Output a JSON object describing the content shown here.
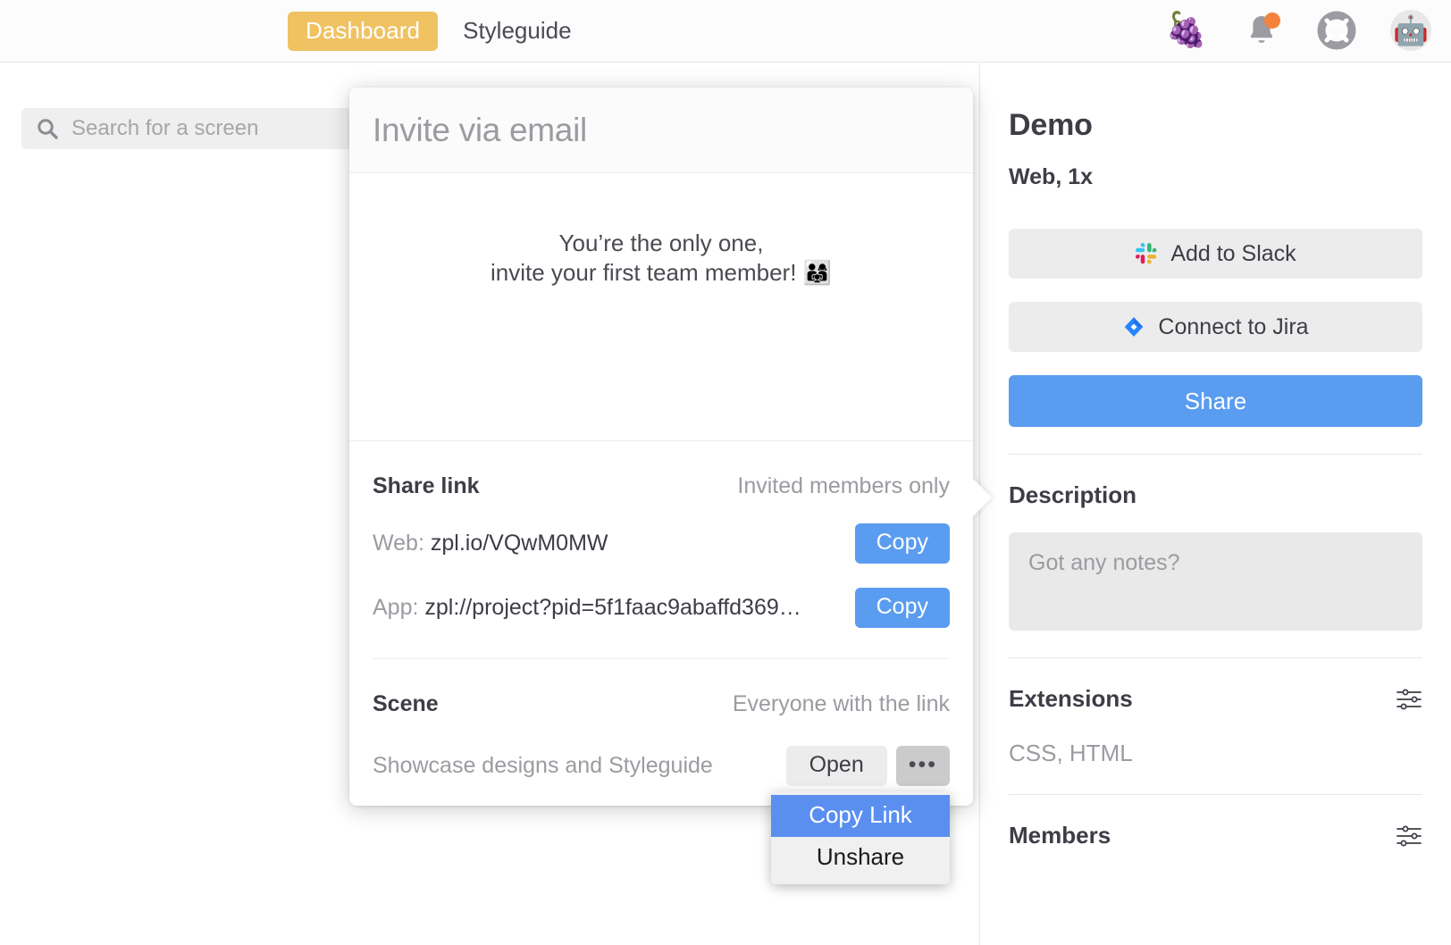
{
  "topbar": {
    "nav": [
      {
        "label": "Dashboard",
        "active": true
      },
      {
        "label": "Styleguide",
        "active": false
      }
    ],
    "icons": [
      {
        "name": "grapes-icon",
        "glyph": "🍇"
      },
      {
        "name": "notifications-bell-icon",
        "glyph": "bell",
        "badge": true
      },
      {
        "name": "help-lifebuoy-icon",
        "glyph": "lifebuoy"
      },
      {
        "name": "user-avatar",
        "glyph": "🤖"
      }
    ]
  },
  "search": {
    "placeholder": "Search for a screen",
    "value": "",
    "icon": "search-icon"
  },
  "sidebar": {
    "project_title": "Demo",
    "project_subtitle": "Web, 1x",
    "slack_button": "Add to Slack",
    "jira_button": "Connect to Jira",
    "share_button": "Share",
    "description_heading": "Description",
    "description_placeholder": "Got any notes?",
    "description_value": "",
    "extensions_heading": "Extensions",
    "extensions_value": "CSS, HTML",
    "members_heading": "Members",
    "settings_icon": "sliders-icon"
  },
  "popover": {
    "title": "Invite via email",
    "empty_line_1": "You’re the only one,",
    "empty_line_2": "invite your first team member! 👨‍👩‍👧",
    "share_link": {
      "heading": "Share link",
      "visibility": "Invited members only",
      "rows": [
        {
          "label": "Web:",
          "value": "zpl.io/VQwM0MW",
          "action": "Copy"
        },
        {
          "label": "App:",
          "value": "zpl://project?pid=5f1faac9abaffd369…",
          "action": "Copy"
        }
      ]
    },
    "scene": {
      "heading": "Scene",
      "visibility": "Everyone with the link",
      "name": "Showcase designs and Styleguide",
      "open_label": "Open",
      "more_label": "•••"
    }
  },
  "context_menu": {
    "items": [
      {
        "label": "Copy Link",
        "highlighted": true
      },
      {
        "label": "Unshare",
        "highlighted": false
      }
    ]
  },
  "colors": {
    "accent_blue": "#5a9cf0",
    "nav_active_yellow": "#f0c262",
    "menu_highlight": "#5a8ff0",
    "badge_orange": "#f4823c",
    "text_dark": "#3d3d46",
    "text_muted": "#9b9ba1"
  }
}
